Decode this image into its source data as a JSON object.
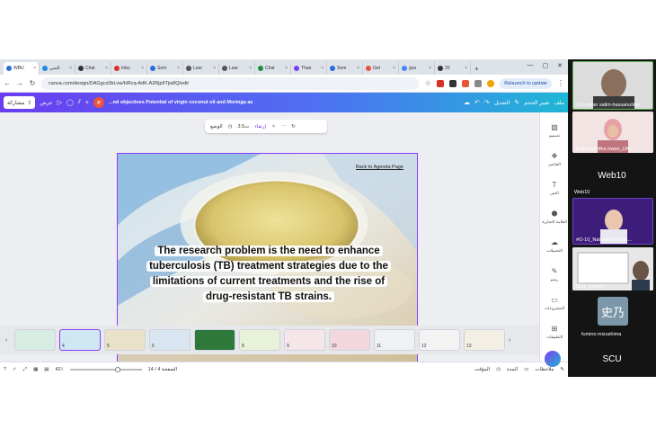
{
  "browser": {
    "tabs": [
      {
        "label": "WBU",
        "color": "#2a6dd9"
      },
      {
        "label": "السي",
        "color": "#1e88e5"
      },
      {
        "label": "Chat",
        "color": "#333333"
      },
      {
        "label": "Inbo",
        "color": "#d93025"
      },
      {
        "label": "Sem",
        "color": "#2a6dd9"
      },
      {
        "label": "Lear",
        "color": "#555555"
      },
      {
        "label": "Lear",
        "color": "#555555"
      },
      {
        "label": "Chat",
        "color": "#1e8e3e"
      },
      {
        "label": "Than",
        "color": "#7a3df0"
      },
      {
        "label": "Sem",
        "color": "#2a6dd9"
      },
      {
        "label": "Get",
        "color": "#e8553a"
      },
      {
        "label": "goo",
        "color": "#4285f4"
      },
      {
        "label": "20",
        "color": "#333333"
      }
    ],
    "url": "canva.com/design/DAGgcz0bLvw/HRcq-AdK-A2Rjp9Tjw8Q/edit",
    "relaunch_label": "Relaunch to update"
  },
  "canva": {
    "share_label": "مشاركة",
    "present_label": "عرض",
    "avatar_initial": "e",
    "doc_title": "...nd objectives Potential of virgin coconut oil and Moringa as",
    "edit_label": "التعديل",
    "resize_label": "تغيير الحجم",
    "file_label": "ملف",
    "float_position": "الوضع",
    "float_duration": "3.5ث",
    "float_animate": "إرتقاء"
  },
  "slide": {
    "back_link": "Back to Agenda Page",
    "lines": [
      "The research problem is the need to enhance",
      "tuberculosis (TB) treatment strategies due to the",
      "limitations of current treatments and the rise of",
      "drug-resistant TB strains."
    ]
  },
  "thumbnails": [
    "4",
    "5",
    "6",
    "7",
    "8",
    "9",
    "10",
    "11",
    "12",
    "13"
  ],
  "statusbar": {
    "zoom": "42٪",
    "page": "الصفحة 4 / 14",
    "duration_label": "المدة",
    "timer_label": "المؤقت",
    "notes_label": "ملاحظات"
  },
  "sidepanel": [
    "تصميم",
    "العناصر",
    "النص",
    "العلامة التجارية",
    "التحميلات",
    "رسم",
    "المشروعات",
    "التطبيقات"
  ],
  "participants": {
    "p1_name": "o11-eman salim-hassanulidin",
    "p2_name": "Andi Masyitha Irwan_UN...",
    "web10_big": "Web10",
    "web10_small": "Web10",
    "p3_name": "#O-10_Natcha Chaikha...",
    "p4_name": "SCU_zoom2",
    "p5_avatar": "史乃",
    "p5_name": "fumino mizushima",
    "scu_label": "SCU"
  },
  "colors": {
    "accent": "#8b3dff",
    "canva_start": "#6a3df0",
    "canva_end": "#1fb7d6"
  }
}
